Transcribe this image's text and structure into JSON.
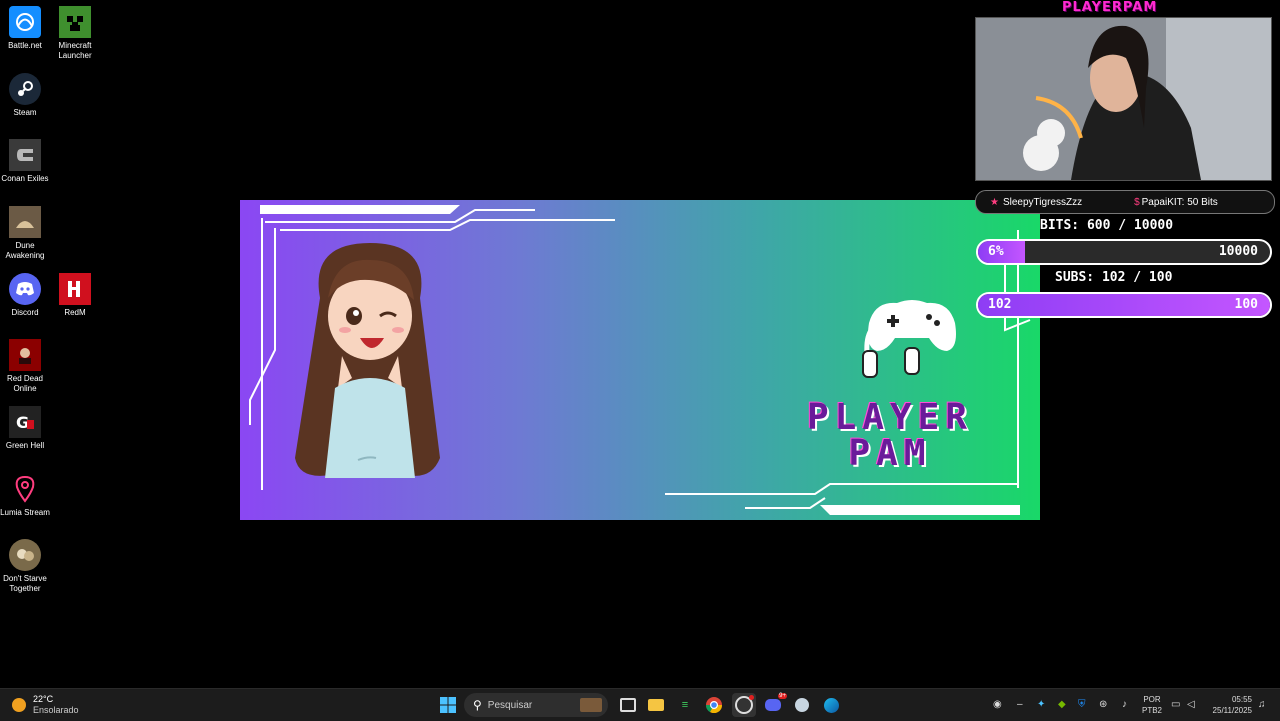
{
  "desktop_icons": [
    {
      "label": "Battle.net",
      "icon": "battlenet-icon",
      "color": "#148eff"
    },
    {
      "label": "Minecraft Launcher",
      "icon": "minecraft-icon",
      "color": "#3f8f2e"
    },
    {
      "label": "Steam",
      "icon": "steam-icon",
      "color": "#1b2838"
    },
    {
      "label": "Conan Exiles",
      "icon": "conan-exiles-icon",
      "color": "#3a3a3a"
    },
    {
      "label": "Dune Awakening",
      "icon": "dune-awakening-icon",
      "color": "#6b5a45"
    },
    {
      "label": "Discord",
      "icon": "discord-icon",
      "color": "#5865f2"
    },
    {
      "label": "RedM",
      "icon": "redm-icon",
      "color": "#d0101e"
    },
    {
      "label": "Red Dead Online",
      "icon": "red-dead-online-icon",
      "color": "#8b0000"
    },
    {
      "label": "Green Hell",
      "icon": "green-hell-icon",
      "color": "#222222"
    },
    {
      "label": "Lumia Stream",
      "icon": "lumia-stream-icon",
      "color": "#111111"
    },
    {
      "label": "Don't Starve Together",
      "icon": "dont-starve-icon",
      "color": "#7a6a4a"
    }
  ],
  "banner": {
    "brand_line1": "PLAYER",
    "brand_line2": "PAM",
    "gradient_start": "#8b47f3",
    "gradient_end": "#19d868"
  },
  "overlay": {
    "webcam_title": "PLAYERPAM",
    "alerts": [
      "SleepyTigressZzz",
      "PapaiKIT: 50 Bits"
    ],
    "bits_goal": {
      "label": "BITS: 600 / 10000",
      "progress_text": "6%",
      "target_text": "10000",
      "fraction": 0.06
    },
    "subs_goal": {
      "label": "SUBS: 102 / 100",
      "progress_text": "102",
      "target_text": "100",
      "fraction": 1.0
    }
  },
  "taskbar": {
    "weather_temp": "22°C",
    "weather_desc": "Ensolarado",
    "search_placeholder": "Pesquisar",
    "lang_line1": "POR",
    "lang_line2": "PTB2",
    "time": "05:55",
    "date": "25/11/2025",
    "discord_badge": "9+"
  }
}
